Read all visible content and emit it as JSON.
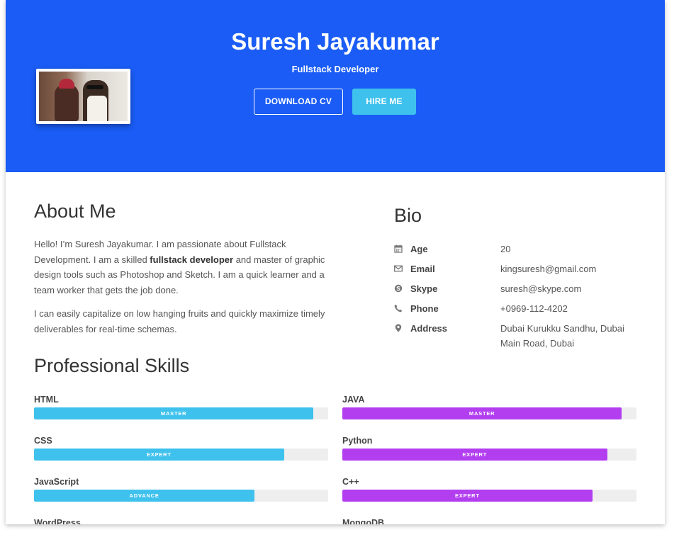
{
  "profile": {
    "name": "Suresh Jayakumar",
    "role": "Fullstack Developer",
    "download_cv_label": "DOWNLOAD CV",
    "hire_me_label": "HIRE ME"
  },
  "about": {
    "title": "About Me",
    "p1_before": "Hello! I’m Suresh Jayakumar. I am passionate about Fullstack Development. I am a skilled ",
    "p1_bold": "fullstack developer",
    "p1_after": " and master of graphic design tools such as Photoshop and Sketch. I am a quick learner and a team worker that gets the job done.",
    "p2": "I can easily capitalize on low hanging fruits and quickly maximize timely deliverables for real-time schemas."
  },
  "bio": {
    "title": "Bio",
    "rows": [
      {
        "icon": "calendar-icon",
        "key": "Age",
        "value": "20"
      },
      {
        "icon": "envelope-icon",
        "key": "Email",
        "value": "kingsuresh@gmail.com"
      },
      {
        "icon": "skype-icon",
        "key": "Skype",
        "value": "suresh@skype.com"
      },
      {
        "icon": "phone-icon",
        "key": "Phone",
        "value": "+0969-112-4202"
      },
      {
        "icon": "map-marker-icon",
        "key": "Address",
        "value": "Dubai Kurukku Sandhu, Dubai Main Road, Dubai"
      }
    ]
  },
  "skills": {
    "title": "Professional Skills",
    "left": [
      {
        "name": "HTML",
        "level": "MASTER",
        "percent": 95
      },
      {
        "name": "CSS",
        "level": "EXPERT",
        "percent": 85
      },
      {
        "name": "JavaScript",
        "level": "ADVANCE",
        "percent": 75
      },
      {
        "name": "WordPress",
        "level": "",
        "percent": 0
      }
    ],
    "right": [
      {
        "name": "JAVA",
        "level": "MASTER",
        "percent": 95
      },
      {
        "name": "Python",
        "level": "EXPERT",
        "percent": 90
      },
      {
        "name": "C++",
        "level": "EXPERT",
        "percent": 85
      },
      {
        "name": "MongoDB",
        "level": "",
        "percent": 0
      }
    ]
  },
  "colors": {
    "header": "#1a5cf5",
    "accent_blue": "#3ec1ec",
    "accent_purple": "#b23ef0"
  }
}
